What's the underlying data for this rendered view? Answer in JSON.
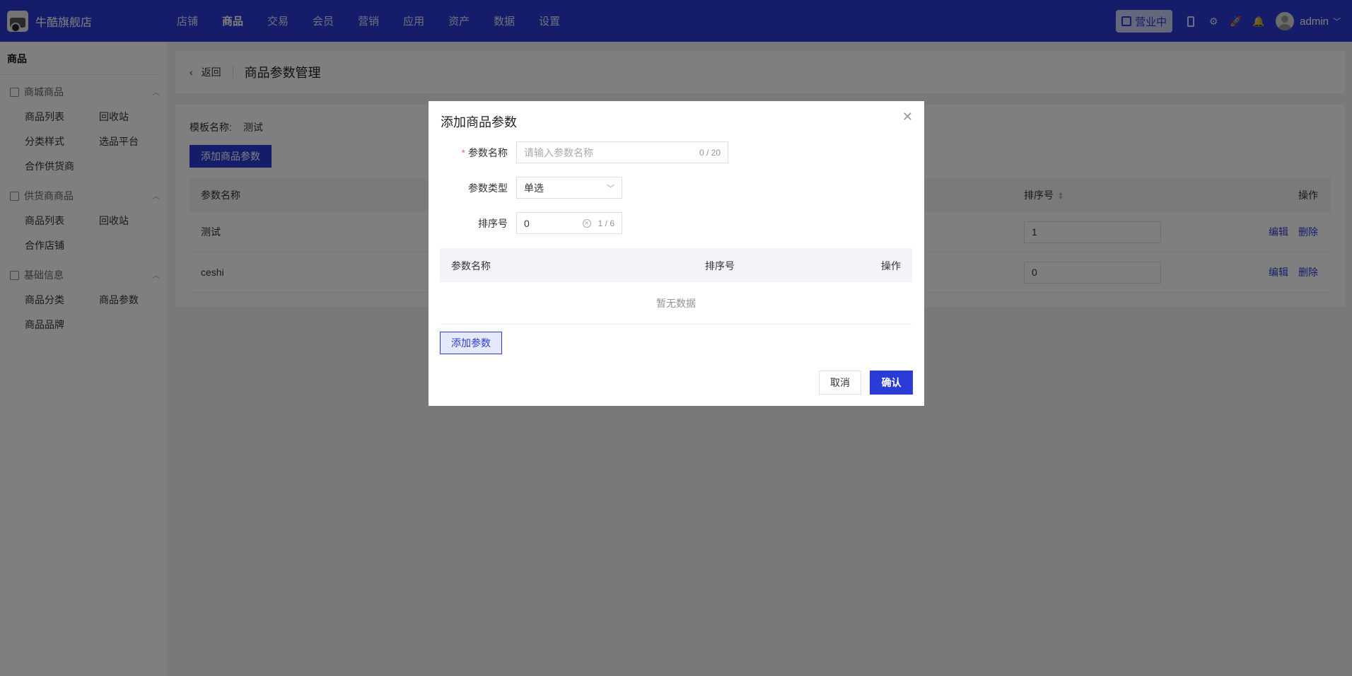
{
  "app": {
    "store_name": "牛酷旗舰店",
    "nav": [
      "店铺",
      "商品",
      "交易",
      "会员",
      "营销",
      "应用",
      "资产",
      "数据",
      "设置"
    ],
    "active_nav": "商品",
    "status_label": "营业中",
    "user_name": "admin",
    "accent_color": "#2a3bd6"
  },
  "sidebar": {
    "title": "商品",
    "groups": [
      {
        "label": "商城商品",
        "icon": "box-icon",
        "items": [
          "商品列表",
          "回收站",
          "分类样式",
          "选品平台",
          "合作供货商"
        ]
      },
      {
        "label": "供货商商品",
        "icon": "warehouse-icon",
        "items": [
          "商品列表",
          "回收站",
          "合作店铺"
        ]
      },
      {
        "label": "基础信息",
        "icon": "document-icon",
        "items": [
          "商品分类",
          "商品参数",
          "商品品牌"
        ]
      }
    ]
  },
  "page": {
    "back_label": "返回",
    "title": "商品参数管理",
    "template_label": "模板名称:",
    "template_name": "测试",
    "add_button": "添加商品参数",
    "table": {
      "columns": [
        "参数名称",
        "排序号",
        "操作"
      ],
      "rows": [
        {
          "name": "测试",
          "sort": "1",
          "actions": [
            "编辑",
            "删除"
          ]
        },
        {
          "name": "ceshi",
          "sort": "0",
          "actions": [
            "编辑",
            "删除"
          ]
        }
      ]
    }
  },
  "dialog": {
    "title": "添加商品参数",
    "fields": {
      "name": {
        "label": "参数名称",
        "placeholder": "请输入参数名称",
        "count": "0 / 20"
      },
      "type": {
        "label": "参数类型",
        "value": "单选"
      },
      "sort": {
        "label": "排序号",
        "value": "0",
        "count": "1 / 6"
      }
    },
    "table": {
      "columns": [
        "参数名称",
        "排序号",
        "操作"
      ],
      "empty_text": "暂无数据"
    },
    "add_param_button": "添加参数",
    "cancel_button": "取消",
    "confirm_button": "确认"
  }
}
